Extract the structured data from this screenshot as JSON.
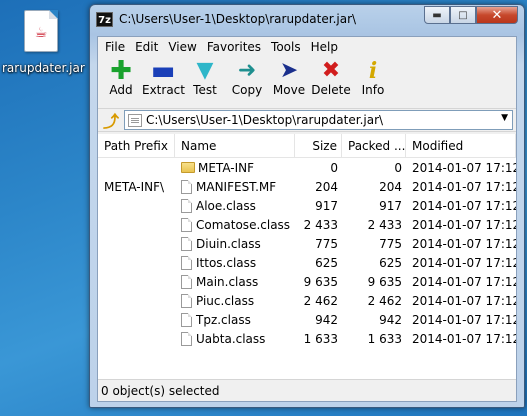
{
  "desktop": {
    "icon_label": "rarupdater.jar"
  },
  "window": {
    "title": "C:\\Users\\User-1\\Desktop\\rarupdater.jar\\",
    "app_icon_text": "7z"
  },
  "menu": [
    "File",
    "Edit",
    "View",
    "Favorites",
    "Tools",
    "Help"
  ],
  "toolbar": [
    {
      "label": "Add",
      "icon": "plus-icon",
      "color": "#19a22d"
    },
    {
      "label": "Extract",
      "icon": "minus-icon",
      "color": "#1a3fb8"
    },
    {
      "label": "Test",
      "icon": "check-down-icon",
      "color": "#2eb6c9"
    },
    {
      "label": "Copy",
      "icon": "copy-arrow-icon",
      "color": "#1e8f8f"
    },
    {
      "label": "Move",
      "icon": "move-arrow-icon",
      "color": "#1a2f8c"
    },
    {
      "label": "Delete",
      "icon": "delete-x-icon",
      "color": "#d11d1d"
    },
    {
      "label": "Info",
      "icon": "info-icon",
      "color": "#d4a800"
    }
  ],
  "address": {
    "path": "C:\\Users\\User-1\\Desktop\\rarupdater.jar\\"
  },
  "columns": {
    "prefix": "Path Prefix",
    "name": "Name",
    "size": "Size",
    "packed": "Packed ...",
    "modified": "Modified"
  },
  "rows": [
    {
      "prefix": "",
      "name": "META-INF",
      "size": "0",
      "packed": "0",
      "modified": "2014-01-07 17:12",
      "type": "folder"
    },
    {
      "prefix": "META-INF\\",
      "name": "MANIFEST.MF",
      "size": "204",
      "packed": "204",
      "modified": "2014-01-07 17:12",
      "type": "file"
    },
    {
      "prefix": "",
      "name": "Aloe.class",
      "size": "917",
      "packed": "917",
      "modified": "2014-01-07 17:12",
      "type": "file"
    },
    {
      "prefix": "",
      "name": "Comatose.class",
      "size": "2 433",
      "packed": "2 433",
      "modified": "2014-01-07 17:12",
      "type": "file"
    },
    {
      "prefix": "",
      "name": "Diuin.class",
      "size": "775",
      "packed": "775",
      "modified": "2014-01-07 17:12",
      "type": "file"
    },
    {
      "prefix": "",
      "name": "Ittos.class",
      "size": "625",
      "packed": "625",
      "modified": "2014-01-07 17:12",
      "type": "file"
    },
    {
      "prefix": "",
      "name": "Main.class",
      "size": "9 635",
      "packed": "9 635",
      "modified": "2014-01-07 17:12",
      "type": "file"
    },
    {
      "prefix": "",
      "name": "Piuc.class",
      "size": "2 462",
      "packed": "2 462",
      "modified": "2014-01-07 17:12",
      "type": "file"
    },
    {
      "prefix": "",
      "name": "Tpz.class",
      "size": "942",
      "packed": "942",
      "modified": "2014-01-07 17:12",
      "type": "file"
    },
    {
      "prefix": "",
      "name": "Uabta.class",
      "size": "1 633",
      "packed": "1 633",
      "modified": "2014-01-07 17:12",
      "type": "file"
    }
  ],
  "status": "0 object(s) selected"
}
